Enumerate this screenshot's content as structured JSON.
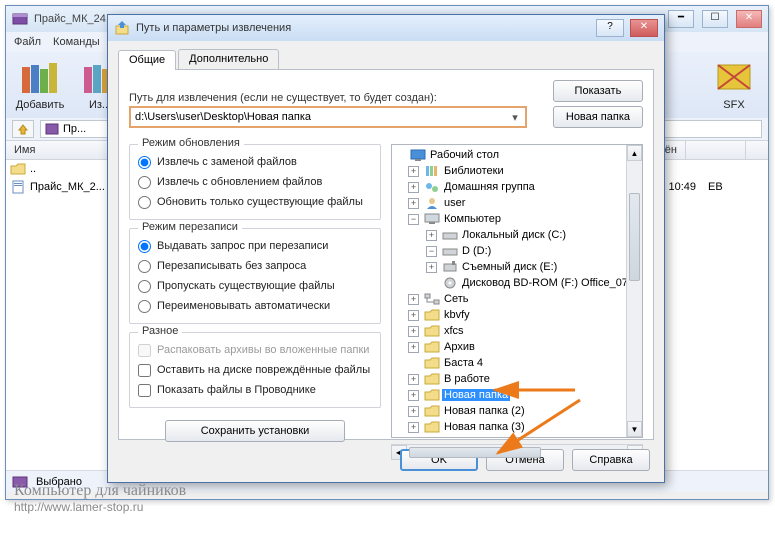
{
  "parent": {
    "title": "Прайс_МК_24.09.2013.zip - WinRAR",
    "menu": [
      "Файл",
      "Команды"
    ],
    "toolbar": {
      "add": "Добавить",
      "extract": "Из...",
      "sfx": "SFX"
    },
    "path_label": "Пр...",
    "list": {
      "cols": {
        "name": "Имя",
        "date": "...нён",
        "type": ""
      },
      "updir": "..",
      "file1": "Прайс_МК_2...",
      "file1_date": "2013 10:49",
      "file1_type": "ЕВ"
    },
    "status": "Выбрано"
  },
  "dialog": {
    "title": "Путь и параметры извлечения",
    "tabs": {
      "general": "Общие",
      "advanced": "Дополнительно"
    },
    "path_label": "Путь для извлечения (если не существует, то будет создан):",
    "path_value": "d:\\Users\\user\\Desktop\\Новая папка",
    "show_btn": "Показать",
    "new_folder_btn": "Новая папка",
    "update_group": {
      "legend": "Режим обновления",
      "r1": "Извлечь с заменой файлов",
      "r2": "Извлечь с обновлением файлов",
      "r3": "Обновить только существующие файлы"
    },
    "overwrite_group": {
      "legend": "Режим перезаписи",
      "r1": "Выдавать запрос при перезаписи",
      "r2": "Перезаписывать без запроса",
      "r3": "Пропускать существующие файлы",
      "r4": "Переименовывать автоматически"
    },
    "misc_group": {
      "legend": "Разное",
      "c1": "Распаковать архивы во вложенные папки",
      "c2": "Оставить на диске повреждённые файлы",
      "c3": "Показать файлы в Проводнике"
    },
    "save_btn": "Сохранить установки",
    "tree": {
      "n0": "Рабочий стол",
      "n1": "Библиотеки",
      "n2": "Домашняя группа",
      "n3": "user",
      "n4": "Компьютер",
      "n4a": "Локальный диск (C:)",
      "n4b": "D (D:)",
      "n4c": "Съемный диск (E:)",
      "n4d": "Дисковод BD-ROM (F:) Office_07",
      "n5": "Сеть",
      "n6": "kbvfy",
      "n7": "xfcs",
      "n8": "Архив",
      "n9": "Баста 4",
      "n10": "В работе",
      "n11": "Новая папка",
      "n12": "Новая папка (2)",
      "n13": "Новая папка (3)"
    },
    "buttons": {
      "ok": "OK",
      "cancel": "Отмена",
      "help": "Справка"
    }
  },
  "watermark": {
    "line1": "Компьютер для чайников",
    "line2": "http://www.lamer-stop.ru"
  }
}
